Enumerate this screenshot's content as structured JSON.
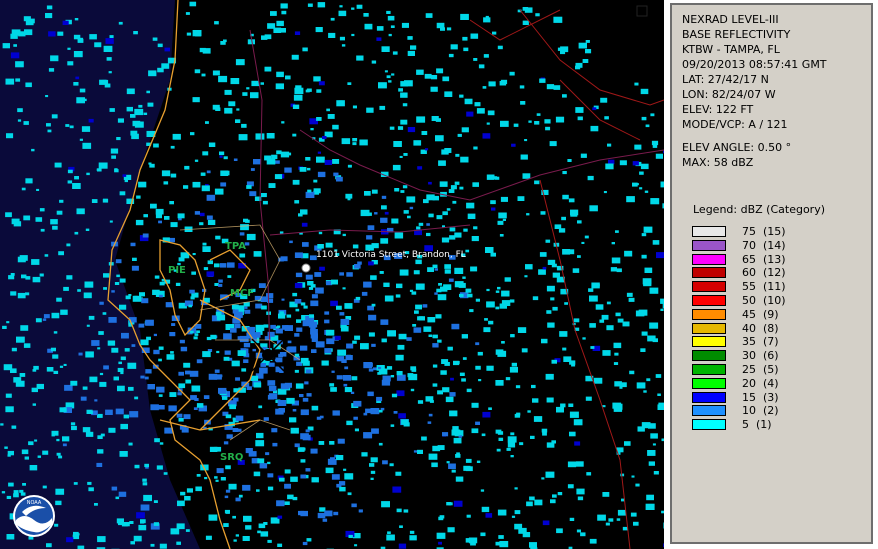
{
  "info": {
    "lines": [
      "NEXRAD LEVEL-III",
      "BASE REFLECTIVITY",
      "KTBW - TAMPA, FL",
      "09/20/2013 08:57:41 GMT",
      "LAT: 27/42/17 N",
      "LON: 82/24/07 W",
      "ELEV: 122 FT",
      "MODE/VCP: A / 121"
    ],
    "elev_angle": "ELEV ANGLE: 0.50 °",
    "max": "MAX: 58 dBZ"
  },
  "legend": {
    "title": "Legend: dBZ (Category)",
    "items": [
      {
        "label": "75  (15)",
        "color": "#e8e8e8"
      },
      {
        "label": "70  (14)",
        "color": "#9a55c8"
      },
      {
        "label": "65  (13)",
        "color": "#ff00ff"
      },
      {
        "label": "60  (12)",
        "color": "#c00000"
      },
      {
        "label": "55  (11)",
        "color": "#d40000"
      },
      {
        "label": "50  (10)",
        "color": "#ff0000"
      },
      {
        "label": "45  (9)",
        "color": "#ff8c00"
      },
      {
        "label": "40  (8)",
        "color": "#e6b800"
      },
      {
        "label": "35  (7)",
        "color": "#ffff00"
      },
      {
        "label": "30  (6)",
        "color": "#008c00"
      },
      {
        "label": "25  (5)",
        "color": "#00b400"
      },
      {
        "label": "20  (4)",
        "color": "#00ff00"
      },
      {
        "label": "15  (3)",
        "color": "#0000ff"
      },
      {
        "label": "10  (2)",
        "color": "#1e90ff"
      },
      {
        "label": "5  (1)",
        "color": "#00ffff"
      }
    ]
  },
  "map": {
    "labels": [
      {
        "name": "map-label-tpa",
        "text": "TPA"
      },
      {
        "name": "map-label-pie",
        "text": "PIE"
      },
      {
        "name": "map-label-mcf",
        "text": "MCF"
      },
      {
        "name": "map-label-srq",
        "text": "SRQ"
      }
    ],
    "location_label": "1101 Victoria Street, Brandon, FL",
    "logo_text": "NOAA"
  }
}
